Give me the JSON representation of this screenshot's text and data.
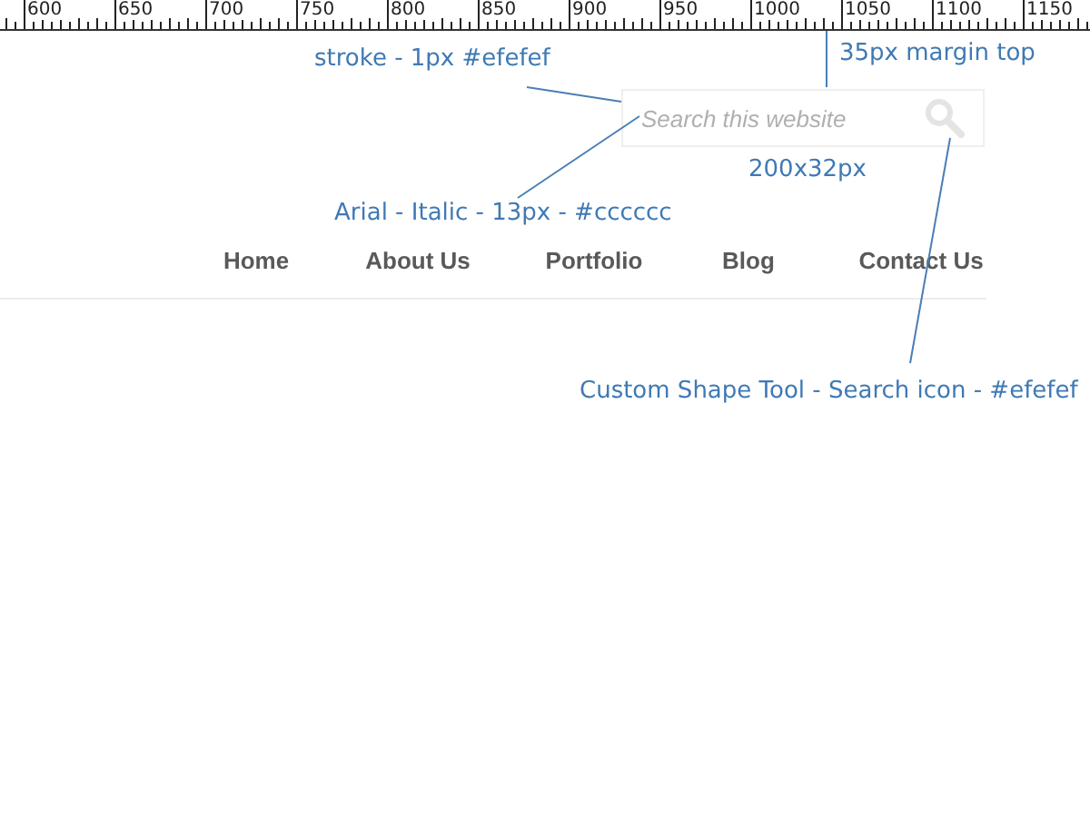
{
  "ruler": {
    "labels": [
      "600",
      "650",
      "700",
      "750",
      "800",
      "850",
      "900",
      "950",
      "1000",
      "1050",
      "1100",
      "1150"
    ]
  },
  "search": {
    "placeholder": "Search this website"
  },
  "nav": [
    {
      "label": "Home"
    },
    {
      "label": "About Us"
    },
    {
      "label": "Portfolio"
    },
    {
      "label": "Blog"
    },
    {
      "label": "Contact Us"
    }
  ],
  "annotations": [
    {
      "text": "stroke - 1px #efefef"
    },
    {
      "text": "35px margin top"
    },
    {
      "text": "200x32px"
    },
    {
      "text": "Arial - Italic - 13px - #cccccc"
    },
    {
      "text": "Custom Shape Tool - Search icon - #efefef"
    }
  ]
}
